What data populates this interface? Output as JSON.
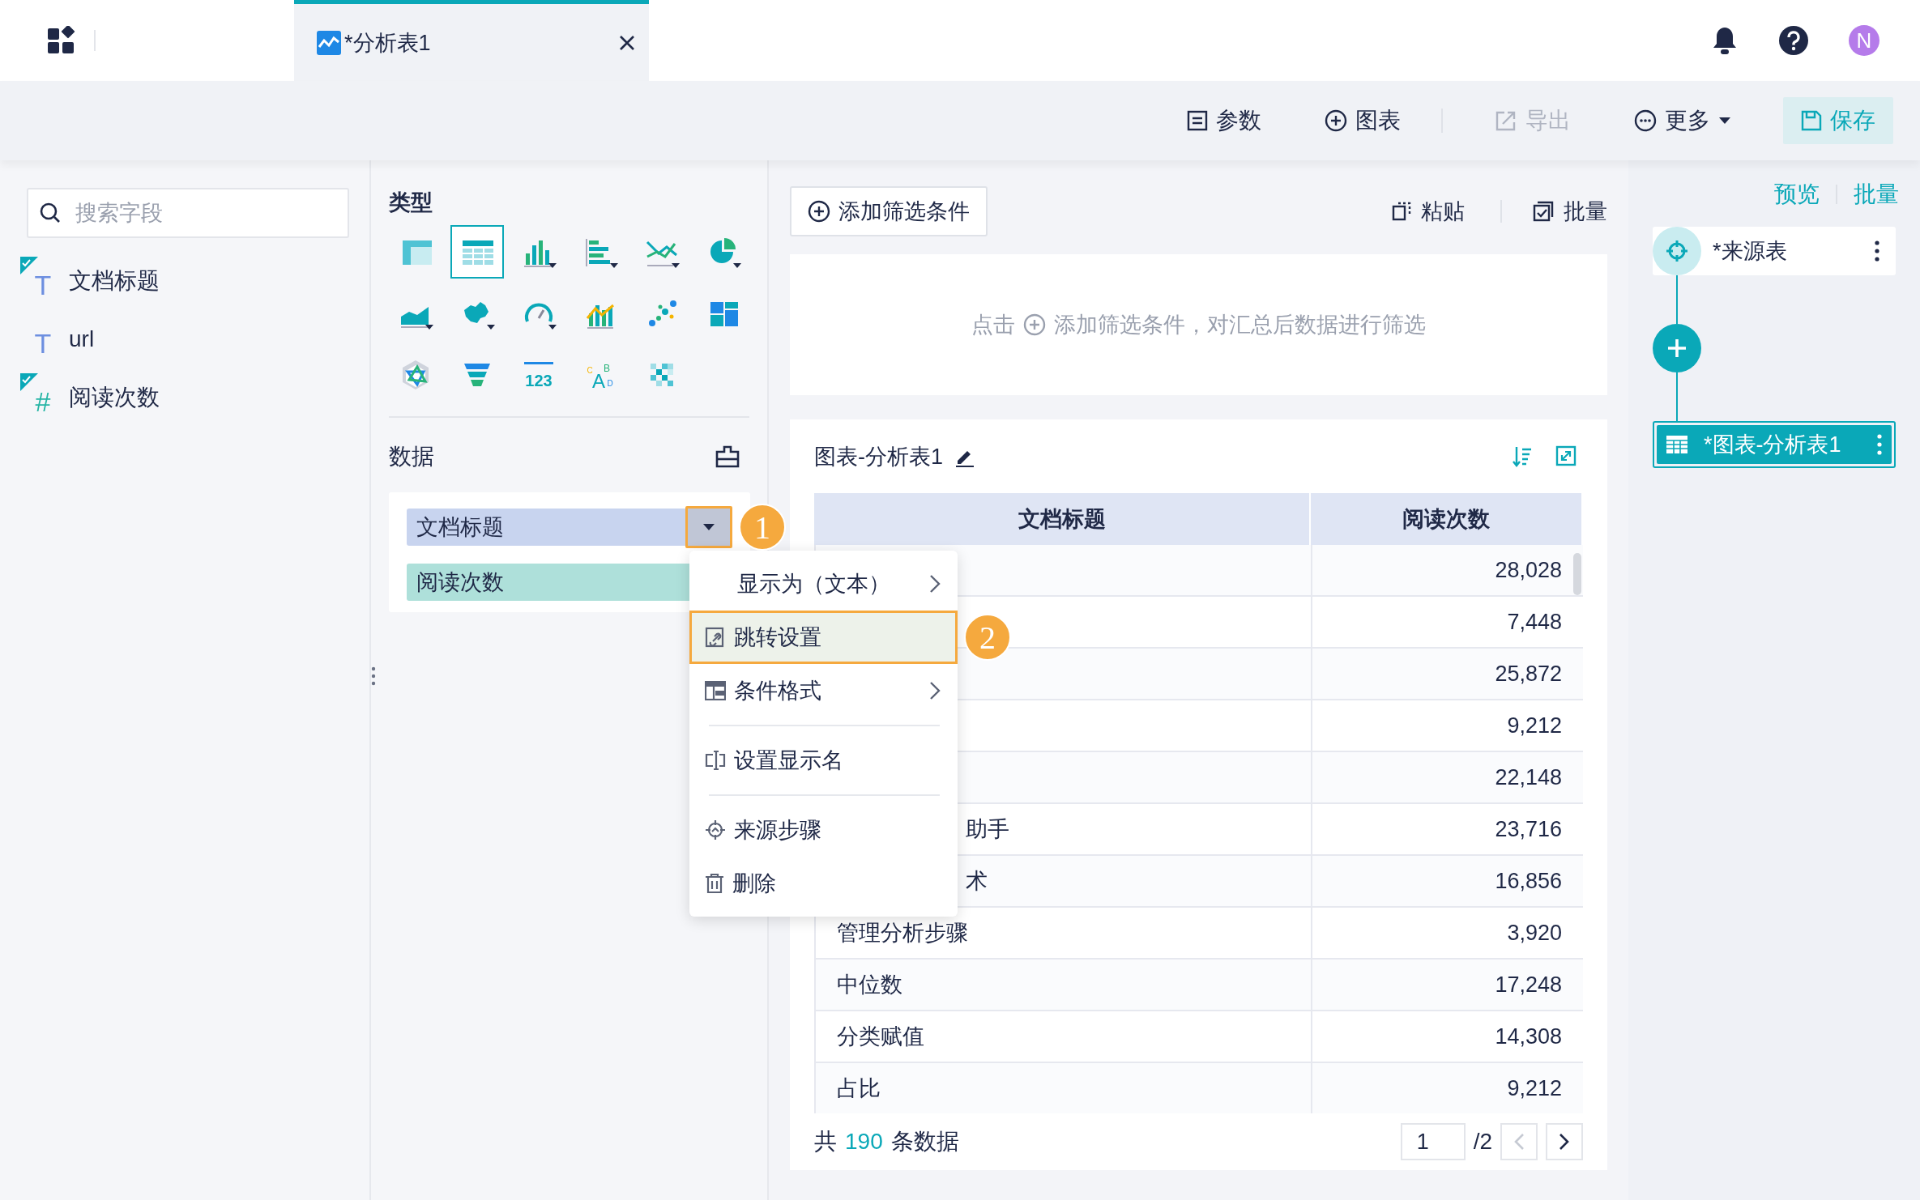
{
  "tab": {
    "title": "*分析表1"
  },
  "header_icons": [
    {
      "kind": "bell"
    },
    {
      "kind": "help"
    },
    {
      "kind": "avatar",
      "label": "N"
    }
  ],
  "toolbar": [
    {
      "label": "参数",
      "kind": "params",
      "disabled": false
    },
    {
      "label": "图表",
      "kind": "chart",
      "disabled": false
    },
    {
      "label": "导出",
      "kind": "export",
      "disabled": true
    },
    {
      "label": "更多",
      "kind": "more",
      "disabled": false
    },
    {
      "label": "保存",
      "kind": "save",
      "disabled": false
    }
  ],
  "field_panel": {
    "search": {
      "placeholder": "搜索字段"
    },
    "fields": [
      {
        "name": "文档标题",
        "glyph": "T",
        "kind": "text",
        "used": true
      },
      {
        "name": "url",
        "glyph": "T",
        "kind": "text",
        "used": false
      },
      {
        "name": "阅读次数",
        "glyph": "#",
        "kind": "number",
        "used": true
      }
    ]
  },
  "config_panel": {
    "type_title": "类型",
    "chart_types": [
      {
        "kind": "crosstab",
        "selected": false
      },
      {
        "kind": "table",
        "selected": true
      },
      {
        "kind": "column",
        "selected": false
      },
      {
        "kind": "bar",
        "selected": false
      },
      {
        "kind": "line",
        "selected": false
      },
      {
        "kind": "pie",
        "selected": false
      },
      {
        "kind": "area",
        "selected": false
      },
      {
        "kind": "map",
        "selected": false
      },
      {
        "kind": "gauge",
        "selected": false
      },
      {
        "kind": "combo",
        "selected": false
      },
      {
        "kind": "scatter",
        "selected": false
      },
      {
        "kind": "treemap",
        "selected": false
      },
      {
        "kind": "radar",
        "selected": false
      },
      {
        "kind": "funnel",
        "selected": false
      },
      {
        "kind": "kpi",
        "selected": false,
        "label": "123"
      },
      {
        "kind": "wordcloud",
        "selected": false,
        "label": "CABD"
      },
      {
        "kind": "heatmap",
        "selected": false
      }
    ],
    "data_title": "数据",
    "data_fields": [
      {
        "name": "文档标题",
        "kind": "dimension",
        "menu_open": true,
        "callout": "1"
      },
      {
        "name": "阅读次数",
        "kind": "measure",
        "menu_open": false
      }
    ]
  },
  "context_menu": [
    {
      "kind": "display",
      "label": "显示为（文本）",
      "submenu": true,
      "selected": false
    },
    {
      "kind": "link",
      "label": "跳转设置",
      "submenu": false,
      "selected": true,
      "callout": "2"
    },
    {
      "kind": "format",
      "label": "条件格式",
      "submenu": true,
      "selected": false
    },
    {
      "kind": "divider"
    },
    {
      "kind": "rename",
      "label": "设置显示名",
      "submenu": false,
      "selected": false
    },
    {
      "kind": "divider"
    },
    {
      "kind": "source",
      "label": "来源步骤",
      "submenu": false,
      "selected": false
    },
    {
      "kind": "delete",
      "label": "删除",
      "submenu": false,
      "selected": false
    }
  ],
  "filter": {
    "add_button": "添加筛选条件",
    "actions": [
      {
        "label": "粘贴",
        "kind": "paste"
      },
      {
        "label": "批量",
        "kind": "batch"
      }
    ],
    "hint_before": "点击",
    "hint_after": "添加筛选条件，对汇总后数据进行筛选"
  },
  "chart_card": {
    "title": "图表-分析表1",
    "table": {
      "columns": [
        "文档标题",
        "阅读次数"
      ],
      "rows": [
        {
          "reads": "28,028"
        },
        {
          "reads": "7,448"
        },
        {
          "reads": "25,872"
        },
        {
          "reads": "9,212"
        },
        {
          "reads": "22,148"
        },
        {
          "title": "助手",
          "covered": true,
          "reads": "23,716"
        },
        {
          "title": "术",
          "covered": true,
          "reads": "16,856"
        },
        {
          "title": "管理分析步骤",
          "covered": false,
          "reads": "3,920"
        },
        {
          "title": "中位数",
          "covered": false,
          "reads": "17,248"
        },
        {
          "title": "分类赋值",
          "covered": false,
          "reads": "14,308"
        },
        {
          "title": "占比",
          "covered": false,
          "reads": "9,212"
        }
      ]
    },
    "footer": {
      "prefix": "共",
      "count": "190",
      "suffix": "条数据",
      "page": "1",
      "pages": "/2",
      "prev_disabled": true
    }
  },
  "flow": {
    "links": [
      "预览",
      "批量"
    ],
    "nodes": [
      {
        "kind": "source",
        "label": "*来源表",
        "selected": false
      },
      {
        "kind": "add"
      },
      {
        "kind": "chart",
        "label": "*图表-分析表1",
        "selected": true
      }
    ]
  }
}
